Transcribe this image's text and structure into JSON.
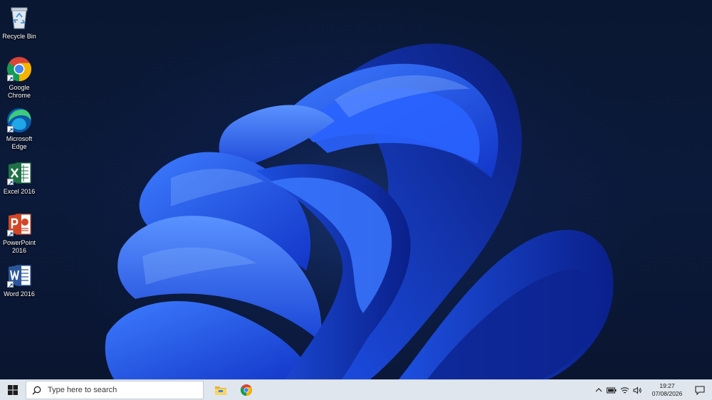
{
  "desktop": {
    "icons": [
      {
        "label": "Recycle Bin",
        "icon": "recycle-bin-icon"
      },
      {
        "label": "Google\nChrome",
        "icon": "chrome-icon"
      },
      {
        "label": "Microsoft\nEdge",
        "icon": "edge-icon"
      },
      {
        "label": "Excel 2016",
        "icon": "excel-icon"
      },
      {
        "label": "PowerPoint\n2016",
        "icon": "powerpoint-icon"
      },
      {
        "label": "Word 2016",
        "icon": "word-icon"
      }
    ],
    "wallpaper": "windows-11-bloom"
  },
  "taskbar": {
    "search_placeholder": "Type here to search",
    "pinned": [
      "file-explorer-icon",
      "chrome-icon"
    ],
    "clock": {
      "time": "19:27",
      "date": "07/08/2026"
    },
    "colors": {
      "background": "#dfe6ee"
    }
  }
}
